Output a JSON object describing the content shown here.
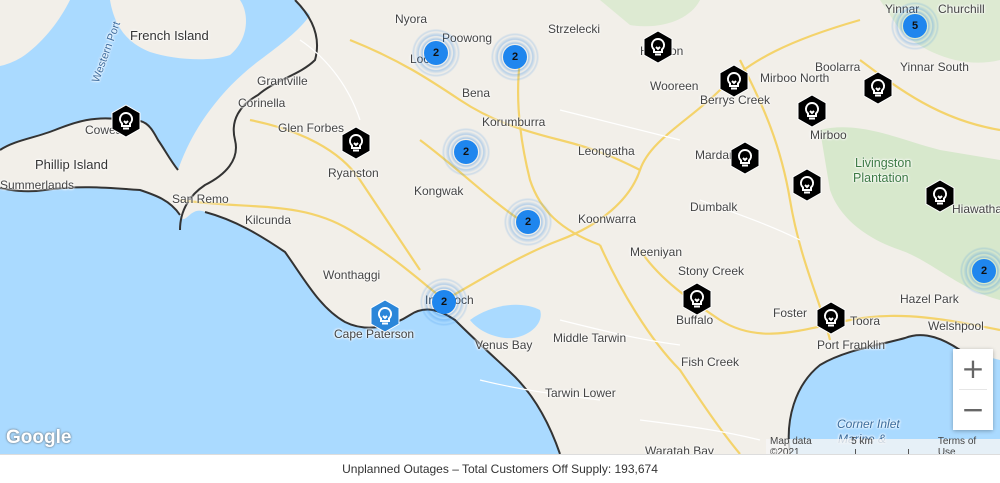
{
  "places": [
    {
      "name": "French Island",
      "cls": "big"
    },
    {
      "name": "Nyora",
      "cls": ""
    },
    {
      "name": "Poowong",
      "cls": ""
    },
    {
      "name": "Strzelecki",
      "cls": ""
    },
    {
      "name": "Yinnar",
      "cls": ""
    },
    {
      "name": "Churchill",
      "cls": ""
    },
    {
      "name": "Loch",
      "cls": ""
    },
    {
      "name": "Grantville",
      "cls": ""
    },
    {
      "name": "Corinella",
      "cls": ""
    },
    {
      "name": "Cowes",
      "cls": ""
    },
    {
      "name": "Phillip Island",
      "cls": "big"
    },
    {
      "name": "Glen Forbes",
      "cls": ""
    },
    {
      "name": "Bena",
      "cls": ""
    },
    {
      "name": "Korumburra",
      "cls": ""
    },
    {
      "name": "Hallston",
      "cls": ""
    },
    {
      "name": "Wooreen",
      "cls": ""
    },
    {
      "name": "Berrys Creek",
      "cls": ""
    },
    {
      "name": "Mirboo North",
      "cls": ""
    },
    {
      "name": "Boolarra",
      "cls": ""
    },
    {
      "name": "Yinnar South",
      "cls": ""
    },
    {
      "name": "Mirboo",
      "cls": ""
    },
    {
      "name": "Leongatha",
      "cls": ""
    },
    {
      "name": "Mardan",
      "cls": ""
    },
    {
      "name": "Livingston",
      "cls": "green"
    },
    {
      "name": "Plantation",
      "cls": "green"
    },
    {
      "name": "Ryanston",
      "cls": ""
    },
    {
      "name": "Kongwak",
      "cls": ""
    },
    {
      "name": "San Remo",
      "cls": ""
    },
    {
      "name": "Kilcunda",
      "cls": ""
    },
    {
      "name": "Koonwarra",
      "cls": ""
    },
    {
      "name": "Dumbalk",
      "cls": ""
    },
    {
      "name": "Hiawatha",
      "cls": ""
    },
    {
      "name": "Summerlands",
      "cls": ""
    },
    {
      "name": "Meeniyan",
      "cls": ""
    },
    {
      "name": "Wonthaggi",
      "cls": ""
    },
    {
      "name": "Stony Creek",
      "cls": ""
    },
    {
      "name": "Hazel Park",
      "cls": ""
    },
    {
      "name": "Inverloch",
      "cls": ""
    },
    {
      "name": "Cape Paterson",
      "cls": ""
    },
    {
      "name": "Buffalo",
      "cls": ""
    },
    {
      "name": "Foster",
      "cls": ""
    },
    {
      "name": "Toora",
      "cls": ""
    },
    {
      "name": "Welshpool",
      "cls": ""
    },
    {
      "name": "Port Franklin",
      "cls": ""
    },
    {
      "name": "Venus Bay",
      "cls": ""
    },
    {
      "name": "Middle Tarwin",
      "cls": ""
    },
    {
      "name": "Fish Creek",
      "cls": ""
    },
    {
      "name": "Tarwin Lower",
      "cls": ""
    },
    {
      "name": "Corner Inlet",
      "cls": "sea"
    },
    {
      "name": "Marine &",
      "cls": "sea"
    },
    {
      "name": "Waratah Bay",
      "cls": ""
    },
    {
      "name": "Western Port",
      "cls": "road"
    }
  ],
  "clusters": [
    {
      "count": "2"
    },
    {
      "count": "2"
    },
    {
      "count": "5"
    },
    {
      "count": "2"
    },
    {
      "count": "2"
    },
    {
      "count": "2"
    },
    {
      "count": "2"
    }
  ],
  "markers": [
    {
      "color": "#000000"
    },
    {
      "color": "#000000"
    },
    {
      "color": "#000000"
    },
    {
      "color": "#000000"
    },
    {
      "color": "#000000"
    },
    {
      "color": "#000000"
    },
    {
      "color": "#000000"
    },
    {
      "color": "#000000"
    },
    {
      "color": "#000000"
    },
    {
      "color": "#000000"
    },
    {
      "color": "#000000"
    },
    {
      "color": "#2b86d9"
    }
  ],
  "controls": {
    "zoom_in": "+",
    "zoom_out": "−"
  },
  "attribution": {
    "logo": "Google",
    "map_data": "Map data ©2021",
    "scale": "5 km",
    "terms": "Terms of Use"
  },
  "footer": {
    "text": "Unplanned Outages – Total Customers Off Supply: 193,674"
  },
  "colors": {
    "water": "#aadaff",
    "land": "#f2efe9",
    "cluster": "#1f86ee",
    "marker_dark": "#000000",
    "marker_blue": "#2b86d9",
    "boundary": "#333333"
  }
}
